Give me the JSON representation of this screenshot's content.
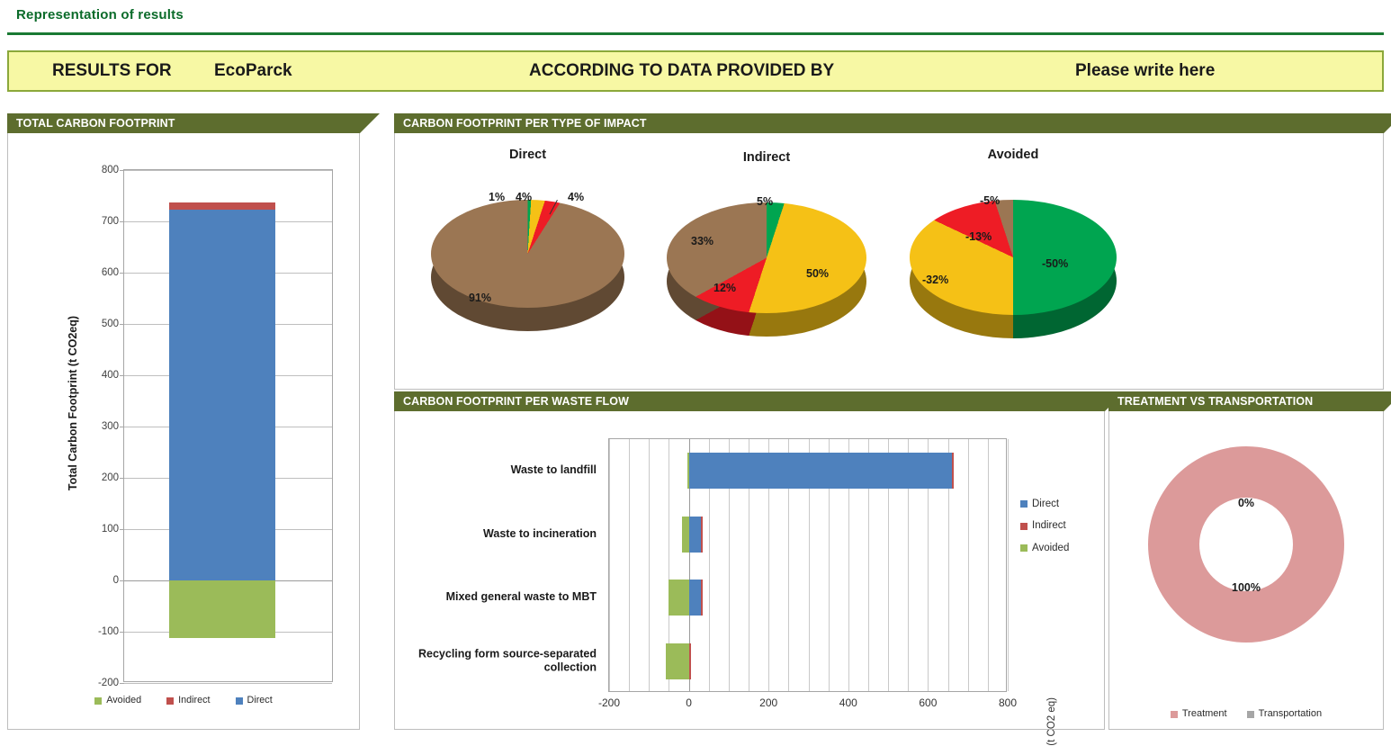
{
  "page": {
    "title": "Representation of results"
  },
  "banner": {
    "results_for_label": "RESULTS FOR",
    "company_name": "EcoParck",
    "according_label": "ACCORDING TO DATA PROVIDED BY",
    "source_placeholder": "Please write here"
  },
  "colors": {
    "tab_green": "#5d6d2e",
    "title_green": "#0b6b2a",
    "banner_yellow": "#f7f8a4",
    "direct_blue": "#4e81bd",
    "indirect_red": "#c0504d",
    "avoided_green": "#9bbb59",
    "pie_green": "#00a550",
    "pie_yellow": "#f5c116",
    "pie_red": "#ee1c25",
    "pie_brown": "#9b7653",
    "treatment_pink": "#dc9a9a",
    "transportation_grey": "#a6a6a6"
  },
  "panels": {
    "total": {
      "tab": "TOTAL CARBON FOOTPRINT"
    },
    "impact": {
      "tab": "CARBON FOOTPRINT PER TYPE OF IMPACT"
    },
    "flow": {
      "tab": "CARBON FOOTPRINT PER WASTE FLOW"
    },
    "transport": {
      "tab": "TREATMENT VS TRANSPORTATION"
    }
  },
  "chart_data": [
    {
      "id": "total_carbon_footprint",
      "type": "bar",
      "title": "TOTAL CARBON FOOTPRINT",
      "stacked": true,
      "categories": [
        "Total"
      ],
      "series": [
        {
          "name": "Avoided",
          "values": [
            -113
          ],
          "color": "#9bbb59"
        },
        {
          "name": "Indirect",
          "values": [
            15
          ],
          "color": "#c0504d"
        },
        {
          "name": "Direct",
          "values": [
            722
          ],
          "color": "#4e81bd"
        }
      ],
      "ylabel": "Total Carbon Footprint (t CO2eq)",
      "xlabel": "",
      "ylim": [
        -200,
        800
      ],
      "yticks": [
        800,
        700,
        600,
        500,
        400,
        300,
        200,
        100,
        0,
        -100,
        -200
      ],
      "ytick_labels": [
        "800",
        "700",
        "600",
        "500",
        "400",
        "300",
        "200",
        "100",
        "0",
        "-100",
        "-200"
      ],
      "grid": true,
      "legend_position": "bottom",
      "legend": [
        "Avoided",
        "Indirect",
        "Direct"
      ]
    },
    {
      "id": "impact_direct",
      "type": "pie",
      "title": "Direct",
      "labels": [
        "RECYCLING FROM SOURCE-SEPARATED COLLECTION",
        "MIXED GENERAL WASTE TO MBT",
        "WASTE TO INCINERATION",
        "WASTE TO LANDFILL"
      ],
      "values": [
        1,
        4,
        4,
        91
      ],
      "display_labels": [
        "1%",
        "4%",
        "4%",
        "91%"
      ],
      "colors": [
        "#00a550",
        "#f5c116",
        "#ee1c25",
        "#9b7653"
      ]
    },
    {
      "id": "impact_indirect",
      "type": "pie",
      "title": "Indirect",
      "labels": [
        "RECYCLING FROM SOURCE-SEPARATED COLLECTION",
        "MIXED GENERAL WASTE TO MBT",
        "WASTE TO INCINERATION",
        "WASTE TO LANDFILL"
      ],
      "values": [
        5,
        50,
        12,
        33
      ],
      "display_labels": [
        "5%",
        "50%",
        "12%",
        "33%"
      ],
      "colors": [
        "#00a550",
        "#f5c116",
        "#ee1c25",
        "#9b7653"
      ]
    },
    {
      "id": "impact_avoided",
      "type": "pie",
      "title": "Avoided",
      "labels": [
        "RECYCLING FROM SOURCE-SEPARATED COLLECTION",
        "MIXED GENERAL WASTE TO MBT",
        "WASTE TO INCINERATION",
        "WASTE TO LANDFILL"
      ],
      "values": [
        50,
        32,
        13,
        5
      ],
      "display_labels": [
        "-50%",
        "-32%",
        "-13%",
        "-5%"
      ],
      "colors": [
        "#00a550",
        "#f5c116",
        "#ee1c25",
        "#9b7653"
      ]
    },
    {
      "id": "carbon_footprint_per_waste_flow",
      "type": "bar",
      "orientation": "horizontal",
      "title": "CARBON FOOTPRINT PER WASTE FLOW",
      "categories": [
        "Waste to landfill",
        "Waste to incineration",
        "Mixed general waste to MBT",
        "Recycling form source-separated collection"
      ],
      "series": [
        {
          "name": "Direct",
          "values": [
            660,
            30,
            30,
            0
          ],
          "color": "#4e81bd"
        },
        {
          "name": "Indirect",
          "values": [
            3,
            2,
            5,
            2
          ],
          "color": "#c0504d"
        },
        {
          "name": "Avoided",
          "values": [
            -3,
            -18,
            -50,
            -58
          ],
          "color": "#9bbb59"
        }
      ],
      "xlabel": "(t CO2 eq)",
      "xlim": [
        -200,
        800
      ],
      "xticks": [
        -200,
        0,
        200,
        400,
        600,
        800
      ],
      "xtick_labels": [
        "-200",
        "0",
        "200",
        "400",
        "600",
        "800"
      ],
      "grid": true,
      "legend_position": "right",
      "legend": [
        "Direct",
        "Indirect",
        "Avoided"
      ]
    },
    {
      "id": "treatment_vs_transportation",
      "type": "pie",
      "variant": "donut",
      "title": "TREATMENT VS TRANSPORTATION",
      "labels": [
        "Treatment",
        "Transportation"
      ],
      "values": [
        100,
        0
      ],
      "display_labels": [
        "100%",
        "0%"
      ],
      "colors": [
        "#dc9a9a",
        "#a6a6a6"
      ],
      "legend_position": "bottom"
    }
  ],
  "impact_legend": [
    {
      "label": "RECYCLING FROM SOURCE-SEPARATED COLLECTION",
      "color": "#00a550"
    },
    {
      "label": "MIXED GENERAL WASTE TO MBT",
      "color": "#f5c116"
    },
    {
      "label": "WASTE TO INCINERATION",
      "color": "#ee1c25"
    },
    {
      "label": "WASTE TO LANDFILL",
      "color": "#9b7653"
    }
  ]
}
